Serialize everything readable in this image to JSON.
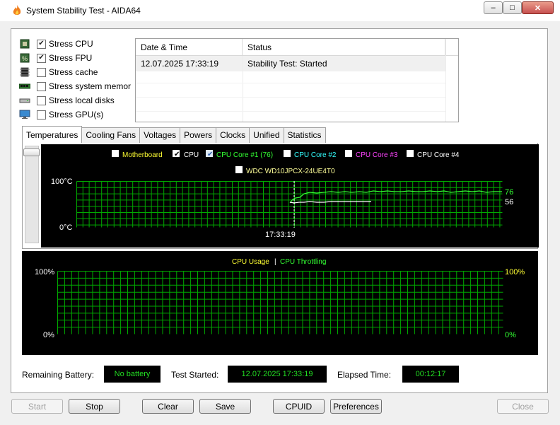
{
  "window": {
    "title": "System Stability Test - AIDA64",
    "min_glyph": "–",
    "max_glyph": "□",
    "close_glyph": "✕"
  },
  "stress_options": [
    {
      "label": "Stress CPU",
      "checked": true,
      "icon": "cpu-chip-icon"
    },
    {
      "label": "Stress FPU",
      "checked": true,
      "icon": "fpu-icon"
    },
    {
      "label": "Stress cache",
      "checked": false,
      "icon": "cache-memory-icon"
    },
    {
      "label": "Stress system memor",
      "checked": false,
      "icon": "ram-module-icon"
    },
    {
      "label": "Stress local disks",
      "checked": false,
      "icon": "hard-disk-icon"
    },
    {
      "label": "Stress GPU(s)",
      "checked": false,
      "icon": "monitor-gpu-icon"
    }
  ],
  "log": {
    "headers": {
      "datetime": "Date & Time",
      "status": "Status"
    },
    "rows": [
      {
        "datetime": "12.07.2025 17:33:19",
        "status": "Stability Test: Started"
      }
    ]
  },
  "tabs": [
    "Temperatures",
    "Cooling Fans",
    "Voltages",
    "Powers",
    "Clocks",
    "Unified",
    "Statistics"
  ],
  "active_tab": "Temperatures",
  "temp_chart": {
    "legend": [
      {
        "label": "Motherboard",
        "checked": false,
        "color": "#ffff33"
      },
      {
        "label": "CPU",
        "checked": true,
        "color": "#ffffff"
      },
      {
        "label": "CPU Core #1 (76)",
        "checked": true,
        "color": "#33ff33"
      },
      {
        "label": "CPU Core #2",
        "checked": false,
        "color": "#33ffff"
      },
      {
        "label": "CPU Core #3",
        "checked": false,
        "color": "#ff44ff"
      },
      {
        "label": "CPU Core #4",
        "checked": false,
        "color": "#ffffff"
      },
      {
        "label": "WDC WD10JPCX-24UE4T0",
        "checked": false,
        "color": "#ffff99"
      }
    ],
    "y_max_label": "100°C",
    "y_min_label": "0°C",
    "marker_time": "17:33:19",
    "value_core1": "76",
    "value_cpu": "56",
    "core1_color": "#33ff33",
    "cpu_color": "#ffffff",
    "grid_color": "#00aa00"
  },
  "usage_chart": {
    "legend_usage": "CPU Usage",
    "legend_sep": "|",
    "legend_throttling": "CPU Throttling",
    "usage_color": "#ffff33",
    "throttling_color": "#33ff33",
    "left_max": "100%",
    "left_min": "0%",
    "right_max": "100%",
    "right_min": "0%"
  },
  "info": {
    "battery_label": "Remaining Battery:",
    "battery_value": "No battery",
    "started_label": "Test Started:",
    "started_value": "12.07.2025 17:33:19",
    "elapsed_label": "Elapsed Time:",
    "elapsed_value": "00:12:17"
  },
  "buttons": {
    "start": "Start",
    "stop": "Stop",
    "clear": "Clear",
    "save": "Save",
    "cpuid": "CPUID",
    "preferences": "Preferences",
    "close": "Close"
  }
}
